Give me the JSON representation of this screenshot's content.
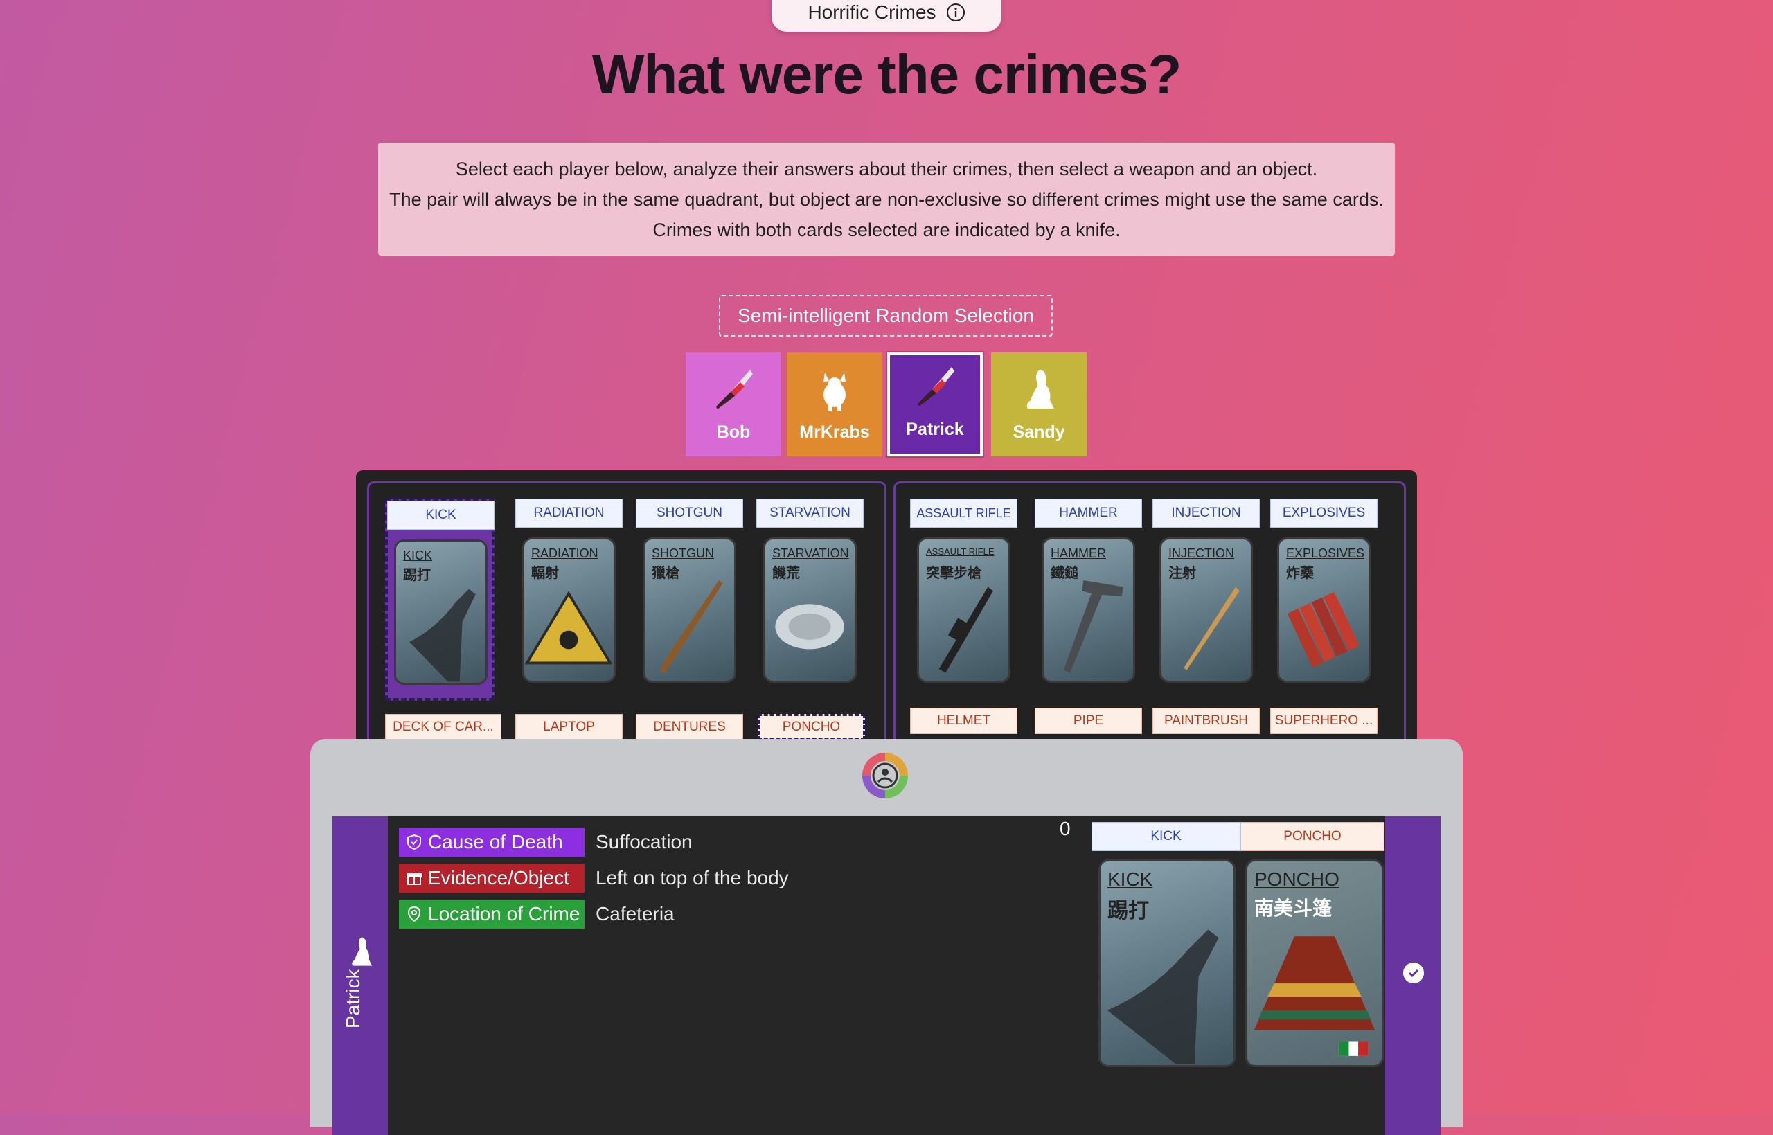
{
  "header": {
    "title": "Horrific Crimes",
    "info_icon": "info-icon"
  },
  "heading": "What were the crimes?",
  "instructions": [
    "Select each player below, analyze their answers about their crimes, then select a weapon and an object.",
    "The pair will always be in the same quadrant, but object are non-exclusive so different crimes might use the same cards.",
    "Crimes with both cards selected are indicated by a knife."
  ],
  "random_button": "Semi-intelligent Random Selection",
  "players": [
    {
      "name": "Bob",
      "color": "#d86ad6",
      "icon": "knife-icon"
    },
    {
      "name": "MrKrabs",
      "color": "#e08a30",
      "icon": "crab-icon"
    },
    {
      "name": "Patrick",
      "color": "#6a2aa8",
      "icon": "knife-icon",
      "selected": true
    },
    {
      "name": "Sandy",
      "color": "#c4b53c",
      "icon": "squirrel-icon"
    }
  ],
  "quadrant_left": {
    "weapons": [
      "KICK",
      "RADIATION",
      "SHOTGUN",
      "STARVATION"
    ],
    "card_names": [
      "KICK",
      "RADIATION",
      "SHOTGUN",
      "STARVATION"
    ],
    "card_cjk": [
      "踢打",
      "輻射",
      "獵槍",
      "饑荒"
    ],
    "objects": [
      "DECK OF CAR...",
      "LAPTOP",
      "DENTURES",
      "PONCHO"
    ]
  },
  "quadrant_right": {
    "weapons": [
      "ASSAULT RIFLE",
      "HAMMER",
      "INJECTION",
      "EXPLOSIVES"
    ],
    "card_names": [
      "ASSAULT RIFLE",
      "HAMMER",
      "INJECTION",
      "EXPLOSIVES"
    ],
    "card_cjk": [
      "突擊步槍",
      "鐵鎚",
      "注射",
      "炸藥"
    ],
    "objects": [
      "HELMET",
      "PIPE",
      "PAINTBRUSH",
      "SUPERHERO ..."
    ]
  },
  "detail": {
    "player_name": "Patrick",
    "clues": [
      {
        "tag": "Cause of Death",
        "value": "Suffocation",
        "color": "#8d2ee0",
        "icon": "shield-icon"
      },
      {
        "tag": "Evidence/Object",
        "value": "Left on top of the body",
        "color": "#b3222b",
        "icon": "gift-icon"
      },
      {
        "tag": "Location of Crime",
        "value": "Cafeteria",
        "color": "#2aa03a",
        "icon": "location-pin-icon"
      }
    ],
    "count": "0",
    "selected_weapon": "KICK",
    "selected_object": "PONCHO",
    "weapon_card": {
      "name": "KICK",
      "cjk": "踢打"
    },
    "object_card": {
      "name": "PONCHO",
      "cjk": "南美斗篷"
    }
  }
}
